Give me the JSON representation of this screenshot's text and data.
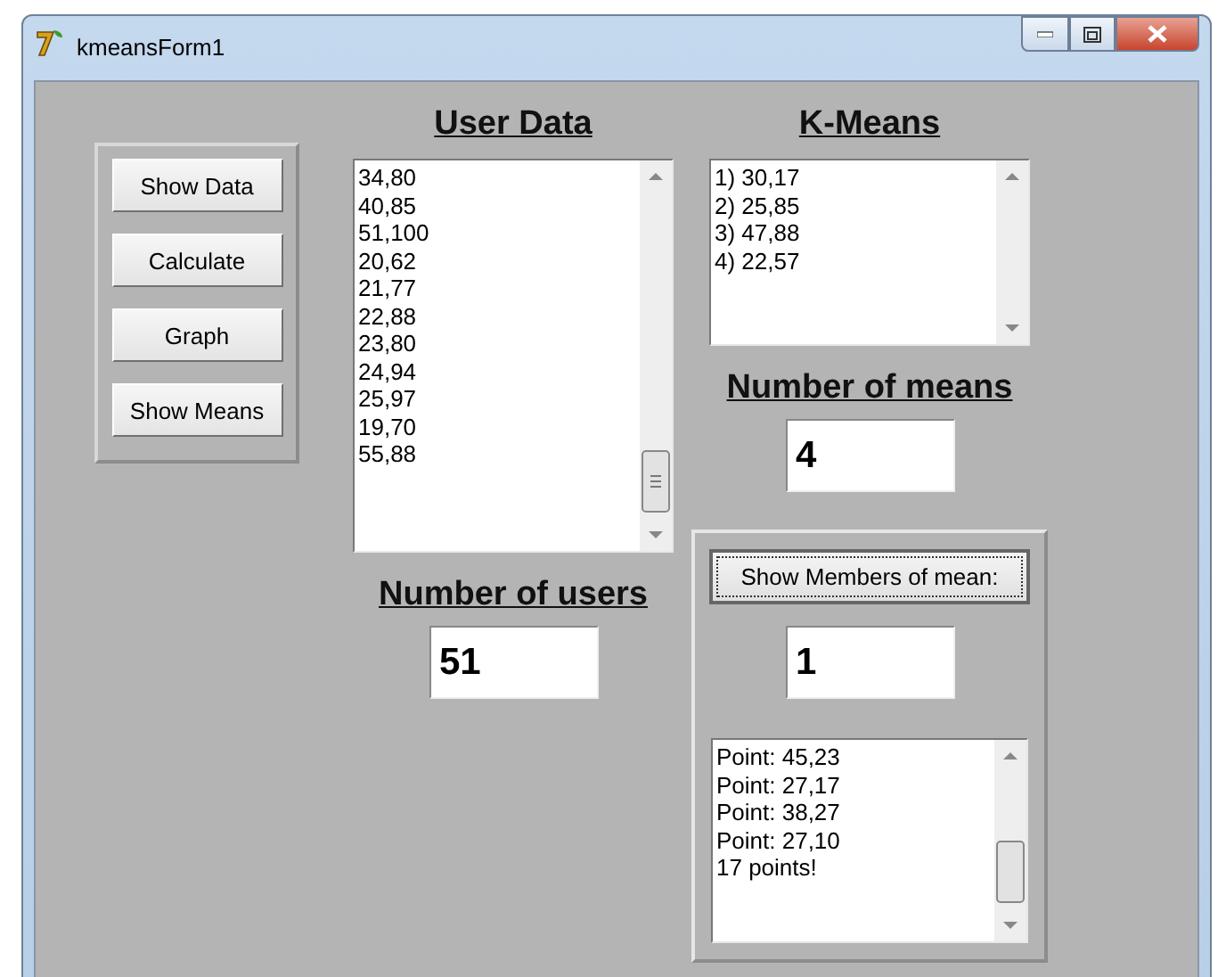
{
  "window": {
    "title": "kmeansForm1"
  },
  "buttons": [
    {
      "label": "Show Data"
    },
    {
      "label": "Calculate"
    },
    {
      "label": "Graph"
    },
    {
      "label": "Show Means"
    }
  ],
  "user_data": {
    "heading": "User Data",
    "items": [
      "34,80",
      "40,85",
      "51,100",
      "20,62",
      "21,77",
      "22,88",
      "23,80",
      "24,94",
      "25,97",
      "19,70",
      "55,88"
    ]
  },
  "number_of_users": {
    "label": "Number of users",
    "value": "51"
  },
  "k_means": {
    "heading": "K-Means",
    "items": [
      "1) 30,17",
      "2) 25,85",
      "3) 47,88",
      "4) 22,57"
    ]
  },
  "number_of_means": {
    "label": "Number of means",
    "value": "4"
  },
  "members": {
    "button": "Show Members of mean:",
    "value": "1",
    "items": [
      "Point: 45,23",
      "Point: 27,17",
      "Point: 38,27",
      "Point: 27,10",
      "17 points!"
    ]
  }
}
